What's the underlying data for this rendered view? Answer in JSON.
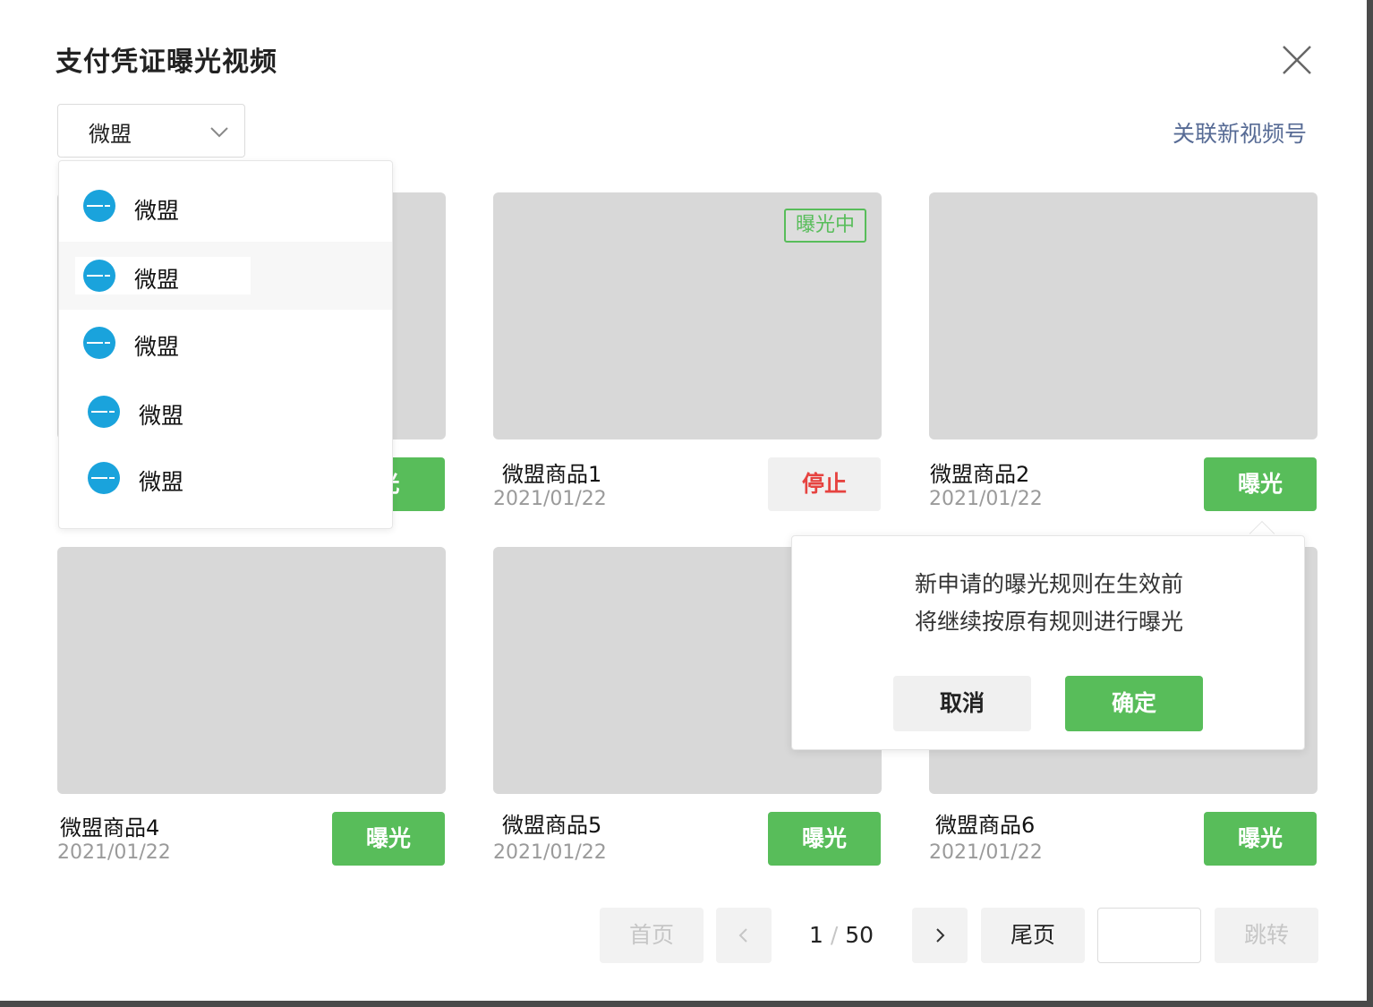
{
  "dialog": {
    "title": "支付凭证曝光视频",
    "close_icon": "close-icon"
  },
  "account_select": {
    "value": "微盟",
    "icon": "chevron-down-icon"
  },
  "link_new_channel": "关联新视频号",
  "dropdown": {
    "items": [
      {
        "label": "微盟",
        "avatar": "weimob-logo-avatar"
      },
      {
        "label": "微盟",
        "avatar": "weimob-logo-avatar",
        "hovered": true
      },
      {
        "label": "微盟",
        "avatar": "weimob-logo-avatar"
      },
      {
        "label": "微盟",
        "avatar": "weimob-logo-avatar"
      },
      {
        "label": "微盟",
        "avatar": "weimob-logo-avatar"
      }
    ]
  },
  "cards": [
    {
      "name": "",
      "date": "",
      "button": "光",
      "button_style": "green"
    },
    {
      "name": "微盟商品1",
      "date": "2021/01/22",
      "button": "停止",
      "button_style": "grey",
      "badge": "曝光中"
    },
    {
      "name": "微盟商品2",
      "date": "2021/01/22",
      "button": "曝光",
      "button_style": "green"
    },
    {
      "name": "微盟商品4",
      "date": "2021/01/22",
      "button": "曝光",
      "button_style": "green"
    },
    {
      "name": "微盟商品5",
      "date": "2021/01/22",
      "button": "曝光",
      "button_style": "green"
    },
    {
      "name": "微盟商品6",
      "date": "2021/01/22",
      "button": "曝光",
      "button_style": "green"
    }
  ],
  "popover": {
    "line1": "新申请的曝光规则在生效前",
    "line2": "将继续按原有规则进行曝光",
    "cancel": "取消",
    "confirm": "确定"
  },
  "pagination": {
    "first": "首页",
    "current": "1",
    "separator": "/",
    "total": "50",
    "last": "尾页",
    "jump_value": "",
    "jump": "跳转"
  },
  "colors": {
    "primary_green": "#58bd5a",
    "danger_red": "#e64340",
    "link_blue": "#576b95",
    "avatar_blue": "#1aa3dc",
    "thumb_grey": "#d8d8d8"
  }
}
